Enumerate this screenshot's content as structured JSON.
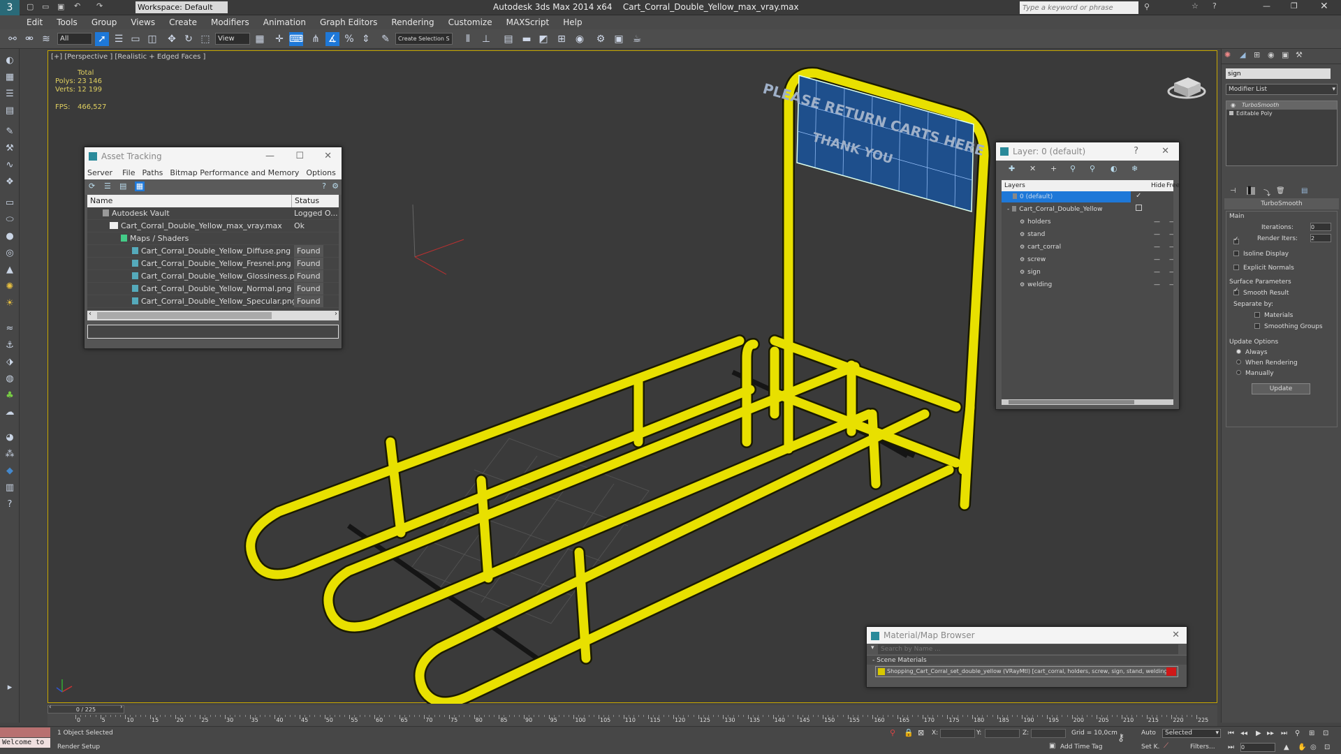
{
  "titlebar": {
    "workspace": "Workspace: Default",
    "app_title": "Autodesk 3ds Max  2014 x64",
    "file_title": "Cart_Corral_Double_Yellow_max_vray.max",
    "search_placeholder": "Type a keyword or phrase"
  },
  "menu": [
    "Edit",
    "Tools",
    "Group",
    "Views",
    "Create",
    "Modifiers",
    "Animation",
    "Graph Editors",
    "Rendering",
    "Customize",
    "MAXScript",
    "Help"
  ],
  "toolbar": {
    "selection_filter": "All",
    "ref_coord": "View",
    "named_selection": "Create Selection S"
  },
  "viewport": {
    "label": "[+] [Perspective ] [Realistic + Edged Faces ]",
    "stats_total": "Total",
    "polys_label": "Polys:",
    "polys_value": "23 146",
    "verts_label": "Verts:",
    "verts_value": "12 199",
    "fps_label": "FPS:",
    "fps_value": "466,527",
    "sign_line1": "PLEASE RETURN CARTS HERE",
    "sign_line2": "THANK YOU"
  },
  "asset_tracking": {
    "title": "Asset Tracking",
    "menu": [
      "Server",
      "File",
      "Paths",
      "Bitmap Performance and Memory",
      "Options"
    ],
    "col_name": "Name",
    "col_status": "Status",
    "rows": [
      {
        "name": "Autodesk Vault",
        "status": "Logged O..."
      },
      {
        "name": "Cart_Corral_Double_Yellow_max_vray.max",
        "status": "Ok"
      },
      {
        "name": "Maps / Shaders",
        "status": ""
      },
      {
        "name": "Cart_Corral_Double_Yellow_Diffuse.png",
        "status": "Found"
      },
      {
        "name": "Cart_Corral_Double_Yellow_Fresnel.png",
        "status": "Found"
      },
      {
        "name": "Cart_Corral_Double_Yellow_Glossiness.png",
        "status": "Found"
      },
      {
        "name": "Cart_Corral_Double_Yellow_Normal.png",
        "status": "Found"
      },
      {
        "name": "Cart_Corral_Double_Yellow_Specular.png",
        "status": "Found"
      }
    ]
  },
  "layer_window": {
    "title": "Layer: 0 (default)",
    "help": "?",
    "col_layers": "Layers",
    "col_hide": "Hide",
    "col_freeze": "Free",
    "rows": [
      {
        "name": "0 (default)"
      },
      {
        "name": "Cart_Corral_Double_Yellow"
      },
      {
        "name": "holders"
      },
      {
        "name": "stand"
      },
      {
        "name": "cart_corral"
      },
      {
        "name": "screw"
      },
      {
        "name": "sign"
      },
      {
        "name": "welding"
      }
    ]
  },
  "material_browser": {
    "title": "Material/Map Browser",
    "search_placeholder": "Search by Name ...",
    "section": "- Scene Materials",
    "material": "Shopping_Cart_Corral_set_double_yellow (VRayMtl) [cart_corral, holders, screw, sign, stand, welding]"
  },
  "command_panel": {
    "object_name": "sign",
    "modifier_list": "Modifier List",
    "stack": [
      "TurboSmooth",
      "Editable Poly"
    ],
    "rollout_title": "TurboSmooth",
    "main_label": "Main",
    "iterations_label": "Iterations:",
    "iterations_value": "0",
    "render_iters_label": "Render Iters:",
    "render_iters_value": "2",
    "isoline_label": "Isoline Display",
    "explicit_label": "Explicit Normals",
    "surface_label": "Surface Parameters",
    "smooth_result_label": "Smooth Result",
    "separate_label": "Separate by:",
    "materials_label": "Materials",
    "smoothing_groups_label": "Smoothing Groups",
    "update_options_label": "Update Options",
    "always_label": "Always",
    "when_rendering_label": "When Rendering",
    "manually_label": "Manually",
    "update_button": "Update"
  },
  "timeline": {
    "frame_counter": "0 / 225",
    "ticks": [
      "0",
      "5",
      "10",
      "15",
      "20",
      "25",
      "30",
      "35",
      "40",
      "45",
      "50",
      "55",
      "60",
      "65",
      "70",
      "75",
      "80",
      "85",
      "90",
      "95",
      "100",
      "105",
      "110",
      "115",
      "120",
      "125",
      "130",
      "135",
      "140",
      "145",
      "150",
      "155",
      "160",
      "165",
      "170",
      "175",
      "180",
      "185",
      "190",
      "195",
      "200",
      "205",
      "210",
      "215",
      "220",
      "225"
    ]
  },
  "statusbar": {
    "listener": "Welcome to",
    "selection_status": "1 Object Selected",
    "prompt": "Render Setup",
    "x_label": "X:",
    "y_label": "Y:",
    "z_label": "Z:",
    "grid": "Grid = 10,0cm",
    "add_time_tag": "Add Time Tag",
    "auto": "Auto",
    "set_k": "Set K.",
    "selected": "Selected",
    "filters": "Filters...",
    "frame": "0"
  },
  "colors": {
    "accent_blue": "#1e78d8",
    "model_yellow": "#e8e000",
    "sign_blue": "#1e4f8c",
    "material_red": "#d01818"
  }
}
